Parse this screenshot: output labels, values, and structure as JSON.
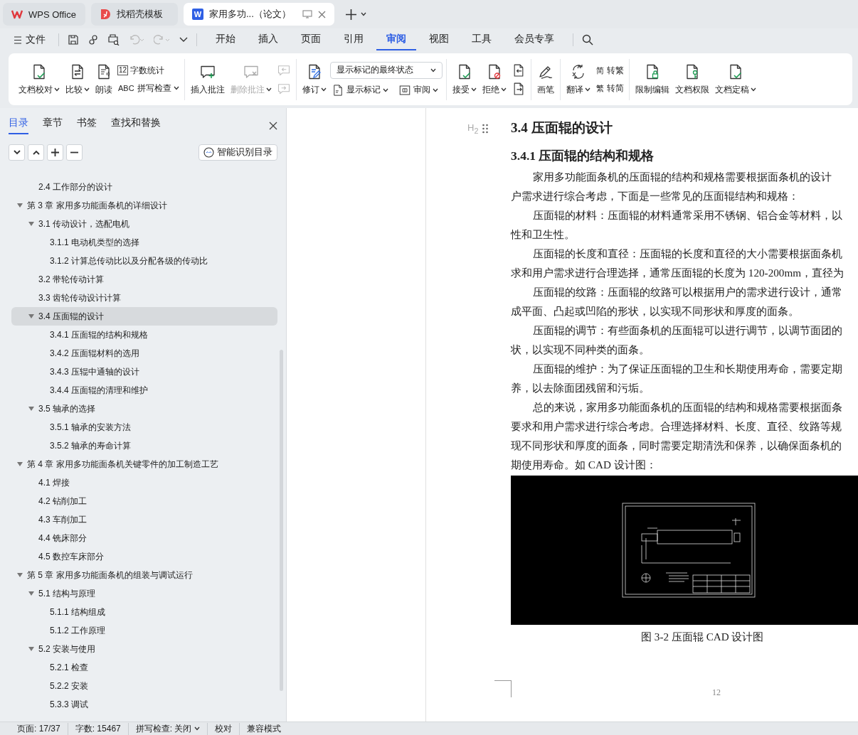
{
  "title_tabs": [
    {
      "kind": "home",
      "label": "WPS Office",
      "selected": false
    },
    {
      "kind": "template",
      "label": "找稻壳模板",
      "selected": false
    },
    {
      "kind": "document",
      "badge": "W",
      "label": "家用多功...（论文）",
      "selected": true
    }
  ],
  "menu": {
    "file": "文件",
    "tabs": [
      {
        "label": "开始",
        "selected": false
      },
      {
        "label": "插入",
        "selected": false
      },
      {
        "label": "页面",
        "selected": false
      },
      {
        "label": "引用",
        "selected": false
      },
      {
        "label": "审阅",
        "selected": true
      },
      {
        "label": "视图",
        "selected": false
      },
      {
        "label": "工具",
        "selected": false
      },
      {
        "label": "会员专享",
        "selected": false
      }
    ]
  },
  "ribbon": {
    "groups": [
      {
        "items": [
          {
            "kind": "large",
            "label": "文档校对",
            "caret": true,
            "disabled": false
          },
          {
            "kind": "large",
            "label": "比较",
            "caret": true,
            "disabled": false
          },
          {
            "kind": "large",
            "label": "朗读",
            "caret": false,
            "disabled": false
          },
          {
            "kind": "stack",
            "rows": [
              [
                {
                  "kind": "small",
                  "glyph": "12",
                  "label": "字数统计",
                  "caret": false,
                  "disabled": false
                }
              ],
              [
                {
                  "kind": "small",
                  "glyph": "ABC",
                  "label": "拼写检查",
                  "caret": true,
                  "disabled": false
                }
              ]
            ]
          }
        ]
      },
      {
        "items": [
          {
            "kind": "large",
            "label": "插入批注",
            "caret": false,
            "disabled": false
          },
          {
            "kind": "large",
            "label": "删除批注",
            "caret": true,
            "disabled": true
          },
          {
            "kind": "stack",
            "rows": [
              [
                {
                  "kind": "icon",
                  "disabled": true
                }
              ],
              [
                {
                  "kind": "icon",
                  "disabled": true
                }
              ]
            ]
          }
        ]
      },
      {
        "items": [
          {
            "kind": "large",
            "label": "修订",
            "caret": true,
            "disabled": false
          },
          {
            "kind": "stack",
            "rows": [
              [
                {
                  "kind": "dropdown",
                  "value": "显示标记的最终状态"
                }
              ],
              [
                {
                  "kind": "small",
                  "label": "显示标记",
                  "caret": true,
                  "disabled": false
                },
                {
                  "kind": "small",
                  "label": "审阅",
                  "caret": true,
                  "disabled": false
                }
              ]
            ]
          }
        ]
      },
      {
        "items": [
          {
            "kind": "large",
            "label": "接受",
            "caret": true,
            "disabled": false
          },
          {
            "kind": "large",
            "label": "拒绝",
            "caret": true,
            "disabled": false
          },
          {
            "kind": "stack",
            "rows": [
              [
                {
                  "kind": "icon",
                  "disabled": false
                }
              ],
              [
                {
                  "kind": "icon",
                  "disabled": false
                }
              ]
            ]
          }
        ]
      },
      {
        "items": [
          {
            "kind": "large",
            "label": "画笔",
            "caret": false,
            "disabled": false
          }
        ]
      },
      {
        "items": [
          {
            "kind": "large",
            "label": "翻译",
            "caret": true,
            "disabled": false
          },
          {
            "kind": "stack",
            "rows": [
              [
                {
                  "kind": "small",
                  "glyph": "简",
                  "label": "转繁",
                  "caret": false,
                  "disabled": false
                }
              ],
              [
                {
                  "kind": "small",
                  "glyph": "繁",
                  "label": "转简",
                  "caret": false,
                  "disabled": false
                }
              ]
            ]
          }
        ]
      },
      {
        "items": [
          {
            "kind": "large",
            "label": "限制编辑",
            "caret": false,
            "disabled": false
          },
          {
            "kind": "large",
            "label": "文档权限",
            "caret": false,
            "disabled": false
          },
          {
            "kind": "large",
            "label": "文档定稿",
            "caret": true,
            "disabled": false
          }
        ]
      }
    ]
  },
  "sidebar": {
    "tabs": [
      {
        "label": "目录",
        "selected": true
      },
      {
        "label": "章节",
        "selected": false
      },
      {
        "label": "书签",
        "selected": false
      },
      {
        "label": "查找和替换",
        "selected": false
      }
    ],
    "smart_button": "智能识别目录",
    "leading_items": [
      {
        "label": "2.4 工作部分的设计",
        "selected": false
      }
    ],
    "toc": [
      {
        "label": "第 3 章  家用多功能面条机的详细设计",
        "selected": false,
        "expanded": true,
        "children": [
          {
            "label": "3.1 传动设计，选配电机",
            "selected": false,
            "expanded": true,
            "children": [
              {
                "label": "3.1.1  电动机类型的选择",
                "selected": false
              },
              {
                "label": "3.1.2  计算总传动比以及分配各级的传动比",
                "selected": false
              }
            ]
          },
          {
            "label": "3.2  带轮传动计算",
            "selected": false
          },
          {
            "label": "3.3  齿轮传动设计计算",
            "selected": false
          },
          {
            "label": "3.4  压面辊的设计",
            "selected": true,
            "expanded": true,
            "children": [
              {
                "label": "3.4.1  压面辊的结构和规格",
                "selected": false
              },
              {
                "label": "3.4.2  压面辊材料的选用",
                "selected": false
              },
              {
                "label": "3.4.3  压辊中通轴的设计",
                "selected": false
              },
              {
                "label": "3.4.4  压面辊的清理和维护",
                "selected": false
              }
            ]
          },
          {
            "label": "3.5  轴承的选择",
            "selected": false,
            "expanded": true,
            "children": [
              {
                "label": "3.5.1 轴承的安装方法",
                "selected": false
              },
              {
                "label": "3.5.2 轴承的寿命计算",
                "selected": false
              }
            ]
          }
        ]
      },
      {
        "label": "第 4 章  家用多功能面条机关键零件的加工制造工艺",
        "selected": false,
        "expanded": true,
        "children": [
          {
            "label": "4.1  焊接",
            "selected": false
          },
          {
            "label": "4.2  钻削加工",
            "selected": false
          },
          {
            "label": "4.3  车削加工",
            "selected": false
          },
          {
            "label": "4.4  铣床部分",
            "selected": false
          },
          {
            "label": "4.5  数控车床部分",
            "selected": false
          }
        ]
      },
      {
        "label": "第 5 章  家用多功能面条机的组装与调试运行",
        "selected": false,
        "expanded": true,
        "children": [
          {
            "label": "5.1 结构与原理",
            "selected": false,
            "expanded": true,
            "children": [
              {
                "label": "5.1.1 结构组成",
                "selected": false
              },
              {
                "label": "5.1.2 工作原理",
                "selected": false
              }
            ]
          },
          {
            "label": "5.2 安装与使用",
            "selected": false,
            "expanded": true,
            "children": [
              {
                "label": "5.2.1 检查",
                "selected": false
              },
              {
                "label": "5.2.2 安装",
                "selected": false
              },
              {
                "label": "5.3.3 调试",
                "selected": false
              }
            ]
          }
        ]
      }
    ]
  },
  "document": {
    "heading_marker": "H$_{2}$",
    "heading": "3.4  压面辊的设计",
    "subheading": "3.4.1  压面辊的结构和规格",
    "lines": [
      {
        "indent": true,
        "text": "家用多功能面条机的压面辊的结构和规格需要根据面条机的设计"
      },
      {
        "indent": false,
        "text": "户需求进行综合考虑，下面是一些常见的压面辊结构和规格："
      },
      {
        "indent": true,
        "text": "压面辊的材料：压面辊的材料通常采用不锈钢、铝合金等材料，以"
      },
      {
        "indent": false,
        "text": "性和卫生性。"
      },
      {
        "indent": true,
        "text": "压面辊的长度和直径：压面辊的长度和直径的大小需要根据面条机"
      },
      {
        "indent": false,
        "text": "求和用户需求进行合理选择，通常压面辊的长度为 120-200mm，直径为"
      },
      {
        "indent": true,
        "text": "压面辊的纹路：压面辊的纹路可以根据用户的需求进行设计，通常"
      },
      {
        "indent": false,
        "text": "成平面、凸起或凹陷的形状，以实现不同形状和厚度的面条。"
      },
      {
        "indent": true,
        "text": "压面辊的调节：有些面条机的压面辊可以进行调节，以调节面团的"
      },
      {
        "indent": false,
        "text": "状，以实现不同种类的面条。"
      },
      {
        "indent": true,
        "text": "压面辊的维护：为了保证压面辊的卫生和长期使用寿命，需要定期"
      },
      {
        "indent": false,
        "text": "养，以去除面团残留和污垢。"
      },
      {
        "indent": true,
        "text": "总的来说，家用多功能面条机的压面辊的结构和规格需要根据面条"
      },
      {
        "indent": false,
        "text": "要求和用户需求进行综合考虑。合理选择材料、长度、直径、纹路等规"
      },
      {
        "indent": false,
        "text": "现不同形状和厚度的面条，同时需要定期清洗和保养，以确保面条机的"
      },
      {
        "indent": false,
        "text": "期使用寿命。如 CAD 设计图："
      }
    ],
    "caption": "图 3-2  压面辊 CAD 设计图",
    "page_number": "12"
  },
  "status_bar": [
    {
      "kind": "text",
      "label": "页面: 17/37"
    },
    {
      "kind": "text",
      "label": "字数: 15467"
    },
    {
      "kind": "menu",
      "label": "拼写检查: 关闭"
    },
    {
      "kind": "button",
      "label": "校对"
    },
    {
      "kind": "text",
      "label": "兼容模式"
    }
  ]
}
